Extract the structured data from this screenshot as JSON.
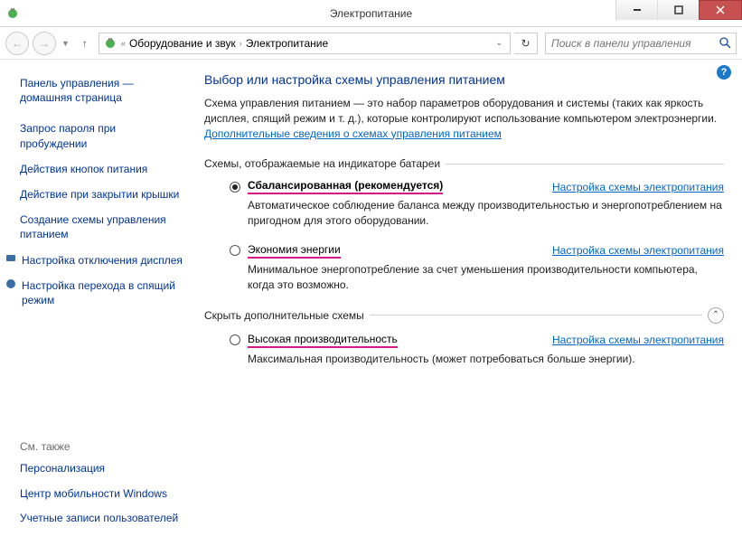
{
  "window": {
    "title": "Электропитание"
  },
  "breadcrumb": {
    "item1": "Оборудование и звук",
    "item2": "Электропитание"
  },
  "search": {
    "placeholder": "Поиск в панели управления"
  },
  "sidebar": {
    "home": "Панель управления — домашняя страница",
    "links": [
      "Запрос пароля при пробуждении",
      "Действия кнопок питания",
      "Действие при закрытии крышки",
      "Создание схемы управления питанием",
      "Настройка отключения дисплея",
      "Настройка перехода в спящий режим"
    ],
    "see_also_h": "См. также",
    "see_also": [
      "Персонализация",
      "Центр мобильности Windows",
      "Учетные записи пользователей"
    ]
  },
  "main": {
    "heading": "Выбор или настройка схемы управления питанием",
    "intro_pre": "Схема управления питанием — это набор параметров оборудования и системы (таких как яркость дисплея, спящий режим и т. д.), которые контролируют использование компьютером электроэнергии. ",
    "intro_link": "Дополнительные сведения о схемах управления питанием",
    "fieldset1": "Схемы, отображаемые на индикаторе батареи",
    "plan1": {
      "name": "Сбалансированная (рекомендуется)",
      "link": "Настройка схемы электропитания",
      "desc": "Автоматическое соблюдение баланса между производительностью и энергопотреблением на пригодном для этого оборудовании."
    },
    "plan2": {
      "name": "Экономия энергии",
      "link": "Настройка схемы электропитания",
      "desc": "Минимальное энергопотребление за счет уменьшения производительности компьютера, когда это возможно."
    },
    "fieldset2": "Скрыть дополнительные схемы",
    "plan3": {
      "name": "Высокая производительность",
      "link": "Настройка схемы электропитания",
      "desc": "Максимальная производительность (может потребоваться больше энергии)."
    }
  }
}
